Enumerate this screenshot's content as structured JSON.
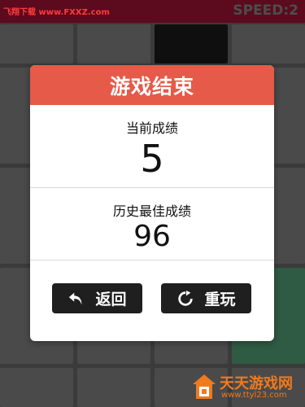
{
  "header": {
    "watermark": "飞翔下载 www.FXXZ.com",
    "speed_text": "SPEED:2"
  },
  "dialog": {
    "title": "游戏结束",
    "current_score_label": "当前成绩",
    "current_score": "5",
    "best_score_label": "历史最佳成绩",
    "best_score": "96",
    "back_label": "返回",
    "replay_label": "重玩"
  },
  "branding": {
    "logo_text": "天天游戏网",
    "logo_url": "www.ttyl23.com"
  },
  "colors": {
    "header_red": "#e55a49",
    "topbar": "#5c0a1e",
    "button": "#1f1f1f",
    "accent_orange": "#f07a1e"
  },
  "icons": {
    "back": "back-arrow-icon",
    "replay": "refresh-icon"
  }
}
